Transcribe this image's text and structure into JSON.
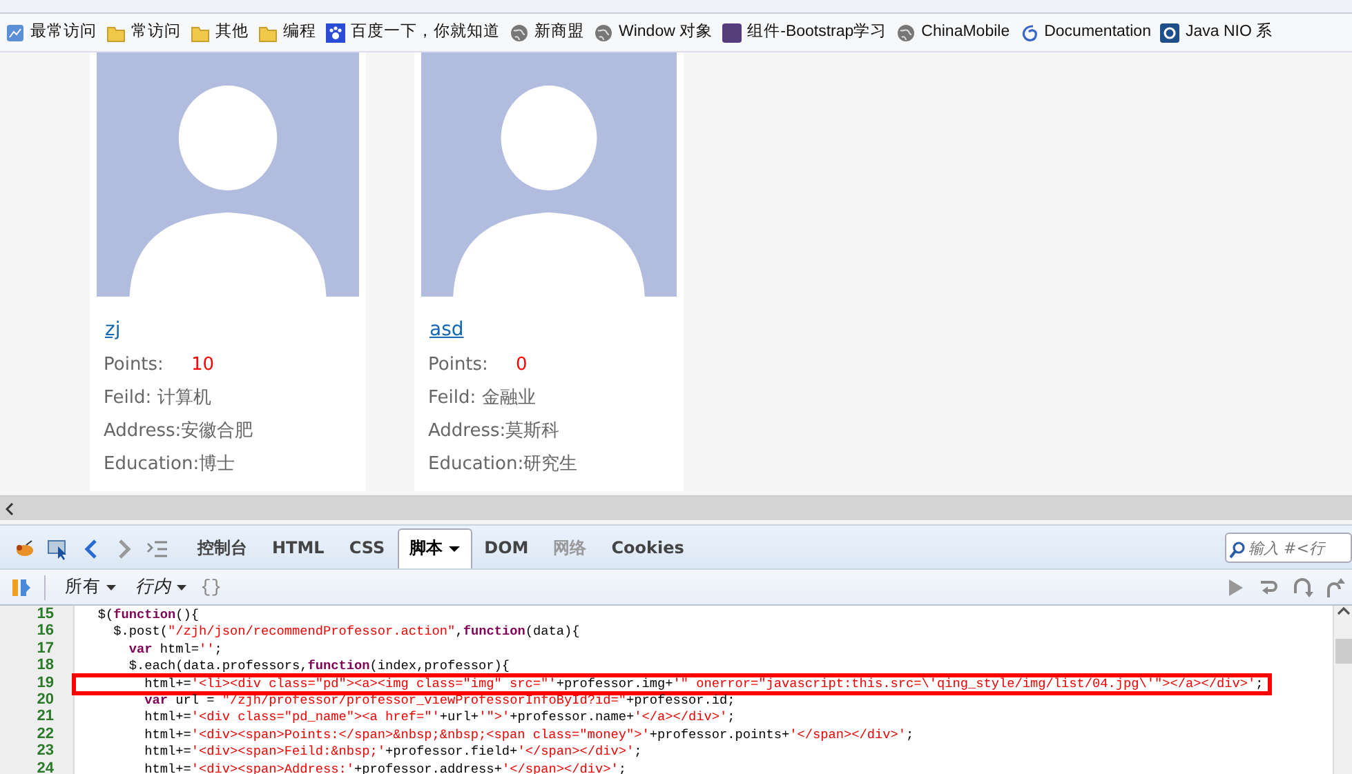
{
  "bookmarks": [
    {
      "label": "最常访问",
      "kind": "page"
    },
    {
      "label": "常访问",
      "kind": "folder"
    },
    {
      "label": "其他",
      "kind": "folder"
    },
    {
      "label": "编程",
      "kind": "folder"
    },
    {
      "label": "百度一下，你就知道",
      "kind": "paw"
    },
    {
      "label": "新商盟",
      "kind": "globe"
    },
    {
      "label": "Window 对象",
      "kind": "globe"
    },
    {
      "label": "组件-Bootstrap学习",
      "kind": "b"
    },
    {
      "label": "ChinaMobile",
      "kind": "globe"
    },
    {
      "label": "Documentation",
      "kind": "swirl"
    },
    {
      "label": "Java NIO 系",
      "kind": "square"
    }
  ],
  "professors": [
    {
      "name": "zj",
      "points_label": "Points:",
      "points": "10",
      "field": "Feild: 计算机",
      "address": "Address:安徽合肥",
      "education": "Education:博士"
    },
    {
      "name": "asd",
      "points_label": "Points:",
      "points": "0",
      "field": "Feild: 金融业",
      "address": "Address:莫斯科",
      "education": "Education:研究生"
    }
  ],
  "devtools": {
    "tabs": [
      {
        "label": "控制台",
        "selected": false,
        "disabled": false
      },
      {
        "label": "HTML",
        "selected": false,
        "disabled": false
      },
      {
        "label": "CSS",
        "selected": false,
        "disabled": false
      },
      {
        "label": "脚本",
        "selected": true,
        "disabled": false
      },
      {
        "label": "DOM",
        "selected": false,
        "disabled": false
      },
      {
        "label": "网络",
        "selected": false,
        "disabled": true
      },
      {
        "label": "Cookies",
        "selected": false,
        "disabled": false
      }
    ],
    "search": {
      "placeholder": "输入 #<行"
    },
    "filters": [
      "所有",
      "行内"
    ],
    "braces": "{}",
    "code": [
      {
        "number": "15",
        "highlighted": false,
        "segments": [
          {
            "kind": "code",
            "text": "   $("
          },
          {
            "kind": "keyword",
            "text": "function"
          },
          {
            "kind": "code",
            "text": "(){"
          }
        ]
      },
      {
        "number": "16",
        "highlighted": false,
        "segments": [
          {
            "kind": "code",
            "text": "     $.post("
          },
          {
            "kind": "string",
            "text": "\"/zjh/json/recommendProfessor.action\""
          },
          {
            "kind": "code",
            "text": ","
          },
          {
            "kind": "keyword",
            "text": "function"
          },
          {
            "kind": "code",
            "text": "(data){"
          }
        ]
      },
      {
        "number": "17",
        "highlighted": false,
        "segments": [
          {
            "kind": "keyword",
            "text": "       var"
          },
          {
            "kind": "code",
            "text": " html="
          },
          {
            "kind": "string",
            "text": "''"
          },
          {
            "kind": "code",
            "text": ";"
          }
        ]
      },
      {
        "number": "18",
        "highlighted": false,
        "segments": [
          {
            "kind": "code",
            "text": "       $.each(data.professors,"
          },
          {
            "kind": "keyword",
            "text": "function"
          },
          {
            "kind": "code",
            "text": "(index,professor){"
          }
        ]
      },
      {
        "number": "19",
        "highlighted": true,
        "segments": [
          {
            "kind": "code",
            "text": "         html+="
          },
          {
            "kind": "string",
            "text": "'<li><div class=\"pd\"><a><img class=\"img\" src=\"'"
          },
          {
            "kind": "code",
            "text": "+professor.img+"
          },
          {
            "kind": "string",
            "text": "'\" onerror=\"javascript:this.src=\\'qing_style/img/list/04.jpg\\'\"></a></div>'"
          },
          {
            "kind": "code",
            "text": ";"
          }
        ]
      },
      {
        "number": "20",
        "highlighted": false,
        "segments": [
          {
            "kind": "keyword",
            "text": "         var"
          },
          {
            "kind": "code",
            "text": " url = "
          },
          {
            "kind": "string",
            "text": "\"/zjh/professor/professor_viewProfessorInfoById?id=\""
          },
          {
            "kind": "code",
            "text": "+professor.id;"
          }
        ]
      },
      {
        "number": "21",
        "highlighted": false,
        "segments": [
          {
            "kind": "code",
            "text": "         html+="
          },
          {
            "kind": "string",
            "text": "'<div class=\"pd_name\"><a href=\"'"
          },
          {
            "kind": "code",
            "text": "+url+"
          },
          {
            "kind": "string",
            "text": "'\">'"
          },
          {
            "kind": "code",
            "text": "+professor.name+"
          },
          {
            "kind": "string",
            "text": "'</a></div>'"
          },
          {
            "kind": "code",
            "text": ";"
          }
        ]
      },
      {
        "number": "22",
        "highlighted": false,
        "segments": [
          {
            "kind": "code",
            "text": "         html+="
          },
          {
            "kind": "string",
            "text": "'<div><span>Points:</span>&nbsp;&nbsp;<span class=\"money\">'"
          },
          {
            "kind": "code",
            "text": "+professor.points+"
          },
          {
            "kind": "string",
            "text": "'</span></div>'"
          },
          {
            "kind": "code",
            "text": ";"
          }
        ]
      },
      {
        "number": "23",
        "highlighted": false,
        "segments": [
          {
            "kind": "code",
            "text": "         html+="
          },
          {
            "kind": "string",
            "text": "'<div><span>Feild:&nbsp;'"
          },
          {
            "kind": "code",
            "text": "+professor.field+"
          },
          {
            "kind": "string",
            "text": "'</span></div>'"
          },
          {
            "kind": "code",
            "text": ";"
          }
        ]
      },
      {
        "number": "24",
        "highlighted": false,
        "segments": [
          {
            "kind": "code",
            "text": "         html+="
          },
          {
            "kind": "string",
            "text": "'<div><span>Address:'"
          },
          {
            "kind": "code",
            "text": "+professor.address+"
          },
          {
            "kind": "string",
            "text": "'</span></div>'"
          },
          {
            "kind": "code",
            "text": ";"
          }
        ]
      }
    ]
  }
}
